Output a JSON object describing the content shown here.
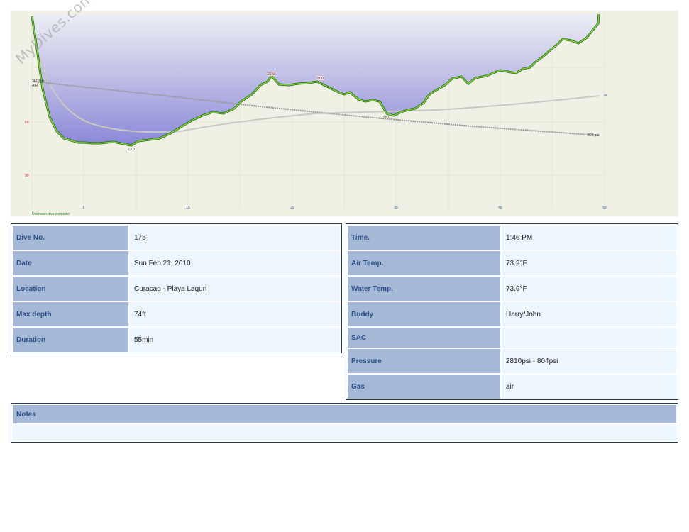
{
  "chart_data": {
    "type": "line",
    "watermark": "MyDives.com",
    "x_ticks": [
      "5",
      "15",
      "25",
      "35",
      "45",
      "55"
    ],
    "y_ticks": [
      "60",
      "90"
    ],
    "depth_labels": [
      "73.0",
      "55.0",
      "22.0",
      "22.0"
    ],
    "pressure_start_label": "2810 psi",
    "pressure_end_label": "804 psi",
    "gas_label": "AIR",
    "right_series_label": "air",
    "computer_label": "Unknown dive computer",
    "colors": {
      "background": "#f1f0e4",
      "fill_top": "#eceef4",
      "fill_bottom": "#8a88d8",
      "profile_outline": "#1b6a1b",
      "profile_line": "#8bd03b",
      "pressure": "#9a9a9a",
      "temperature": "#c9c9c0"
    }
  },
  "dive_info": [
    {
      "label": "Dive No.",
      "value": "175"
    },
    {
      "label": "Date",
      "value": "Sun Feb 21, 2010"
    },
    {
      "label": "Location",
      "value": "Curacao - Playa Lagun"
    },
    {
      "label": "Max depth",
      "value": "74ft"
    },
    {
      "label": "Duration",
      "value": "55min"
    }
  ],
  "dive_details": [
    {
      "label": "Time.",
      "value": "1:46 PM"
    },
    {
      "label": "Air Temp.",
      "value": "73.9°F"
    },
    {
      "label": "Water Temp.",
      "value": "73.9°F"
    },
    {
      "label": "Buddy",
      "value": "Harry/John"
    },
    {
      "label": "SAC",
      "value": ""
    },
    {
      "label": "Pressure",
      "value": "2810psi - 804psi"
    },
    {
      "label": "Gas",
      "value": "air"
    }
  ],
  "notes": {
    "label": "Notes",
    "value": ""
  }
}
